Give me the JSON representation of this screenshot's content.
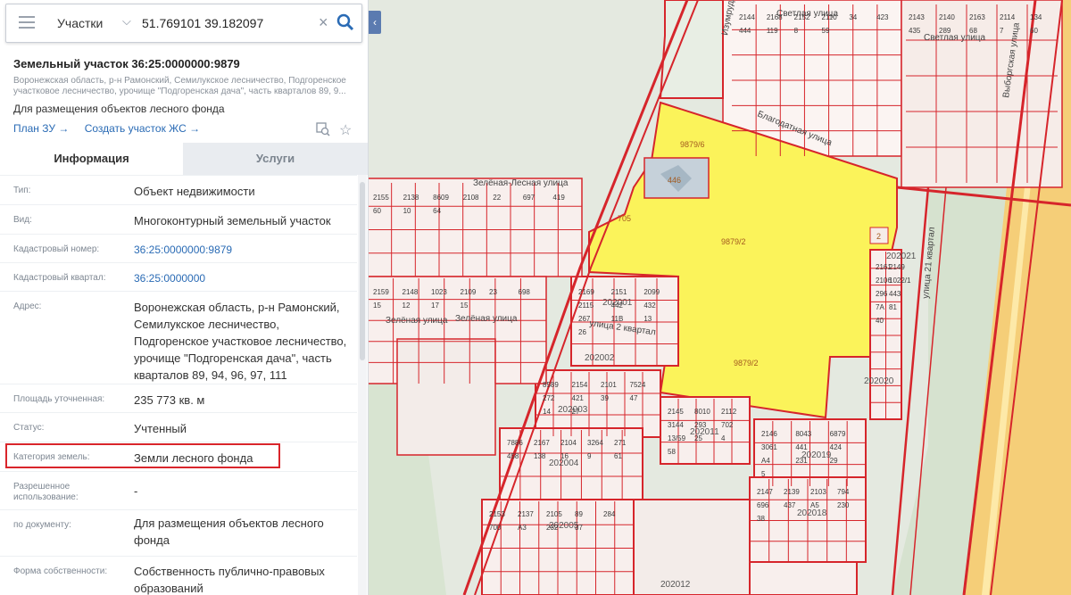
{
  "search": {
    "type_label": "Участки",
    "query": "51.769101 39.182097"
  },
  "parcel": {
    "title": "Земельный участок 36:25:0000000:9879",
    "address_short": "Воронежская область, р-н Рамонский, Семилукское лесничество, Подгоренское участковое лесничество, урочище \"Подгоренская дача\", часть кварталов 89, 9...",
    "purpose": "Для размещения объектов лесного фонда",
    "link_plan": "План ЗУ →",
    "link_create": "Создать участок ЖС →"
  },
  "tabs": [
    "Информация",
    "Услуги"
  ],
  "info": [
    {
      "label": "Тип:",
      "value": "Объект недвижимости"
    },
    {
      "label": "Вид:",
      "value": "Многоконтурный земельный участок"
    },
    {
      "label": "Кадастровый номер:",
      "value": "36:25:0000000:9879"
    },
    {
      "label": "Кадастровый квартал:",
      "value": "36:25:0000000"
    },
    {
      "label": "Адрес:",
      "value": "Воронежская область, р-н Рамонский, Семилукское лесничество, Подгоренское участковое лесничество, урочище \"Подгоренская дача\", часть кварталов 89, 94, 96, 97, 111"
    },
    {
      "label": "Площадь уточненная:",
      "value": "235 773 кв. м"
    },
    {
      "label": "Статус:",
      "value": "Учтенный"
    },
    {
      "label": "Категория земель:",
      "value": "Земли лесного фонда"
    },
    {
      "label": "Разрешенное использование:",
      "value": "-"
    },
    {
      "label": "по документу:",
      "value": "Для размещения объектов лесного фонда"
    },
    {
      "label": "Форма собственности:",
      "value": "Собственность публично-правовых образований"
    }
  ],
  "map": {
    "streets": [
      "Светлая улица",
      "Светлая улица",
      "Выборгская улица",
      "Благодатная улица",
      "Зелёная-Лесная улица",
      "Зелёная улица",
      "Зелёная улица",
      "улица 2 квартал",
      "улица 21 квартал",
      "Изумрудная"
    ],
    "parcel_labels": [
      "9879/6",
      "9879/2",
      "9879/2",
      "446",
      "705",
      "2"
    ],
    "block_labels": [
      "202001",
      "202002",
      "202003",
      "202004",
      "202005",
      "202011",
      "202012",
      "202018",
      "202019",
      "202020",
      "202021"
    ],
    "plot_labels": [
      "2144",
      "2143",
      "2155",
      "2159",
      "2169",
      "8589",
      "7886",
      "2145",
      "2146",
      "2147",
      "2153",
      "2161",
      "2168",
      "2140",
      "2138",
      "2148",
      "2151",
      "2154",
      "2167",
      "8010",
      "8043",
      "2139",
      "2137",
      "2149",
      "2152",
      "2163",
      "8609",
      "1023",
      "2099",
      "2101",
      "2104",
      "2112",
      "6879",
      "2103",
      "2105",
      "2106",
      "2110",
      "2114",
      "2108",
      "2109",
      "2115",
      "7524",
      "3264",
      "3144",
      "3061",
      "794",
      "89",
      "1022/1",
      "34",
      "134",
      "22",
      "23",
      "442",
      "272",
      "271",
      "293",
      "441",
      "696",
      "284",
      "296",
      "423",
      "435",
      "697",
      "698",
      "432",
      "421",
      "458",
      "702",
      "424",
      "437",
      "700",
      "443",
      "444",
      "289",
      "419",
      "15",
      "267",
      "39",
      "138",
      "13/59",
      "A4",
      "A5",
      "A3",
      "7A",
      "119",
      "68",
      "60",
      "12",
      "11B",
      "47",
      "16",
      "25",
      "231",
      "230",
      "232",
      "81",
      "8",
      "7",
      "10",
      "17",
      "13",
      "14",
      "9",
      "4",
      "29",
      "38",
      "37",
      "40",
      "59",
      "60",
      "64",
      "15",
      "26",
      "27",
      "61",
      "58",
      "5"
    ],
    "colors": {
      "forest": "#dde6d6",
      "highway": "#f5ce78",
      "selected": "#fbf35a",
      "border": "#d6252b",
      "plot_fill": "#fbf4f2"
    }
  }
}
